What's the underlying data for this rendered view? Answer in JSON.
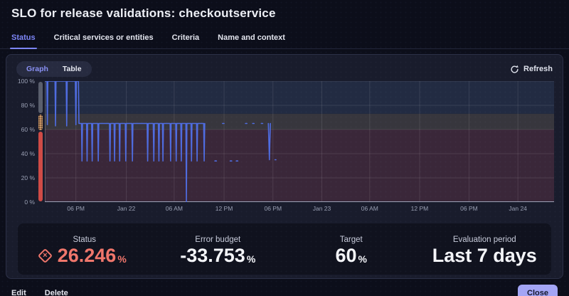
{
  "header": {
    "title": "SLO for release validations: checkoutservice"
  },
  "tabs": [
    {
      "label": "Status",
      "active": true
    },
    {
      "label": "Critical services or entities",
      "active": false
    },
    {
      "label": "Criteria",
      "active": false
    },
    {
      "label": "Name and context",
      "active": false
    }
  ],
  "toolbar": {
    "view_toggle": [
      "Graph",
      "Table"
    ],
    "active_view": "Graph",
    "refresh_label": "Refresh"
  },
  "chart_data": {
    "type": "line",
    "title": "SLO status over time (last 7 days shown from Jan 21 PM to Jan 24 AM)",
    "unit": "%",
    "ylim": [
      0,
      100
    ],
    "grid": true,
    "line_color": "#4f6ce0",
    "y_ticks": [
      {
        "label": "100 %",
        "value": 100
      },
      {
        "label": "80 %",
        "value": 80
      },
      {
        "label": "60 %",
        "value": 60
      },
      {
        "label": "40 %",
        "value": 40
      },
      {
        "label": "20 %",
        "value": 20
      },
      {
        "label": "0 %",
        "value": 0
      }
    ],
    "x_ticks": [
      {
        "label": "06 PM",
        "frac": 0.061
      },
      {
        "label": "Jan 22",
        "frac": 0.16
      },
      {
        "label": "06 AM",
        "frac": 0.254
      },
      {
        "label": "12 PM",
        "frac": 0.352
      },
      {
        "label": "06 PM",
        "frac": 0.448
      },
      {
        "label": "Jan 23",
        "frac": 0.544
      },
      {
        "label": "06 AM",
        "frac": 0.638
      },
      {
        "label": "12 PM",
        "frac": 0.736
      },
      {
        "label": "06 PM",
        "frac": 0.833
      },
      {
        "label": "Jan 24",
        "frac": 0.929
      }
    ],
    "bands": [
      {
        "zone": "normal",
        "from": 73,
        "to": 100,
        "color": "#222b42"
      },
      {
        "zone": "warning",
        "from": 60,
        "to": 73,
        "color": "#37363d"
      },
      {
        "zone": "failure",
        "from": 0,
        "to": 60,
        "color": "#3a2739"
      }
    ],
    "status_strip": [
      {
        "zone": "normal",
        "from": 73,
        "to": 100
      },
      {
        "zone": "warning",
        "from": 60,
        "to": 73
      },
      {
        "zone": "failure",
        "from": 0,
        "to": 60
      }
    ],
    "points": [
      [
        0.0,
        100
      ],
      [
        0.004,
        100
      ],
      [
        0.005,
        64
      ],
      [
        0.006,
        100
      ],
      [
        0.02,
        100
      ],
      [
        0.021,
        63
      ],
      [
        0.022,
        100
      ],
      [
        0.042,
        100
      ],
      [
        0.043,
        63
      ],
      [
        0.044,
        100
      ],
      [
        0.06,
        100
      ],
      [
        0.061,
        64
      ],
      [
        0.062,
        100
      ],
      [
        0.066,
        100
      ],
      [
        0.067,
        65
      ],
      [
        0.072,
        65
      ],
      [
        0.073,
        34
      ],
      [
        0.074,
        65
      ],
      [
        0.082,
        65
      ],
      [
        0.083,
        34
      ],
      [
        0.084,
        65
      ],
      [
        0.092,
        65
      ],
      [
        0.093,
        34
      ],
      [
        0.094,
        65
      ],
      [
        0.104,
        65
      ],
      [
        0.105,
        34
      ],
      [
        0.106,
        65
      ],
      [
        0.127,
        65
      ],
      [
        0.128,
        34
      ],
      [
        0.129,
        65
      ],
      [
        0.136,
        65
      ],
      [
        0.137,
        34
      ],
      [
        0.138,
        65
      ],
      [
        0.146,
        65
      ],
      [
        0.147,
        34
      ],
      [
        0.148,
        65
      ],
      [
        0.158,
        65
      ],
      [
        0.159,
        34
      ],
      [
        0.16,
        65
      ],
      [
        0.171,
        65
      ],
      [
        0.172,
        34
      ],
      [
        0.173,
        65
      ],
      [
        0.201,
        65
      ],
      [
        0.202,
        34
      ],
      [
        0.203,
        65
      ],
      [
        0.213,
        65
      ],
      [
        0.214,
        34
      ],
      [
        0.215,
        65
      ],
      [
        0.223,
        65
      ],
      [
        0.224,
        34
      ],
      [
        0.225,
        65
      ],
      [
        0.231,
        65
      ],
      [
        0.232,
        34
      ],
      [
        0.233,
        65
      ],
      [
        0.246,
        65
      ],
      [
        0.247,
        34
      ],
      [
        0.248,
        65
      ],
      [
        0.257,
        65
      ],
      [
        0.258,
        34
      ],
      [
        0.259,
        65
      ],
      [
        0.267,
        65
      ],
      [
        0.268,
        34
      ],
      [
        0.269,
        65
      ],
      [
        0.277,
        65
      ],
      [
        0.278,
        0
      ],
      [
        0.279,
        65
      ],
      [
        0.287,
        65
      ],
      [
        0.288,
        34
      ],
      [
        0.289,
        65
      ],
      [
        0.298,
        65
      ],
      [
        0.299,
        34
      ],
      [
        0.3,
        65
      ],
      [
        0.312,
        65
      ],
      [
        0.313,
        34
      ],
      [
        0.314,
        65
      ],
      null,
      [
        0.334,
        34
      ],
      [
        0.337,
        34
      ],
      null,
      [
        0.349,
        65
      ],
      [
        0.352,
        65
      ],
      null,
      [
        0.364,
        34
      ],
      [
        0.367,
        34
      ],
      null,
      [
        0.376,
        34
      ],
      [
        0.379,
        34
      ],
      null,
      [
        0.394,
        65
      ],
      [
        0.397,
        65
      ],
      null,
      [
        0.408,
        65
      ],
      [
        0.411,
        65
      ],
      null,
      [
        0.425,
        65
      ],
      [
        0.428,
        65
      ],
      null,
      [
        0.439,
        65
      ],
      [
        0.441,
        35
      ],
      [
        0.443,
        65
      ],
      null,
      [
        0.452,
        35
      ],
      [
        0.454,
        35
      ]
    ]
  },
  "summary": {
    "status": {
      "label": "Status",
      "value": "26.246",
      "unit": "%",
      "state": "failure"
    },
    "error_budget": {
      "label": "Error budget",
      "value": "-33.753",
      "unit": "%"
    },
    "target": {
      "label": "Target",
      "value": "60",
      "unit": "%"
    },
    "evaluation_period": {
      "label": "Evaluation period",
      "value": "Last 7 days"
    }
  },
  "footer": {
    "edit_label": "Edit",
    "delete_label": "Delete",
    "close_label": "Close"
  },
  "colors": {
    "accent": "#7d86f8",
    "chart_line": "#4f6ce0",
    "status_failure": "#f0766b",
    "strip_normal": "#5a5f6d",
    "strip_warning": "#d09a66",
    "strip_failure": "#cf4b46",
    "close_button_bg": "#a3a5f5"
  }
}
